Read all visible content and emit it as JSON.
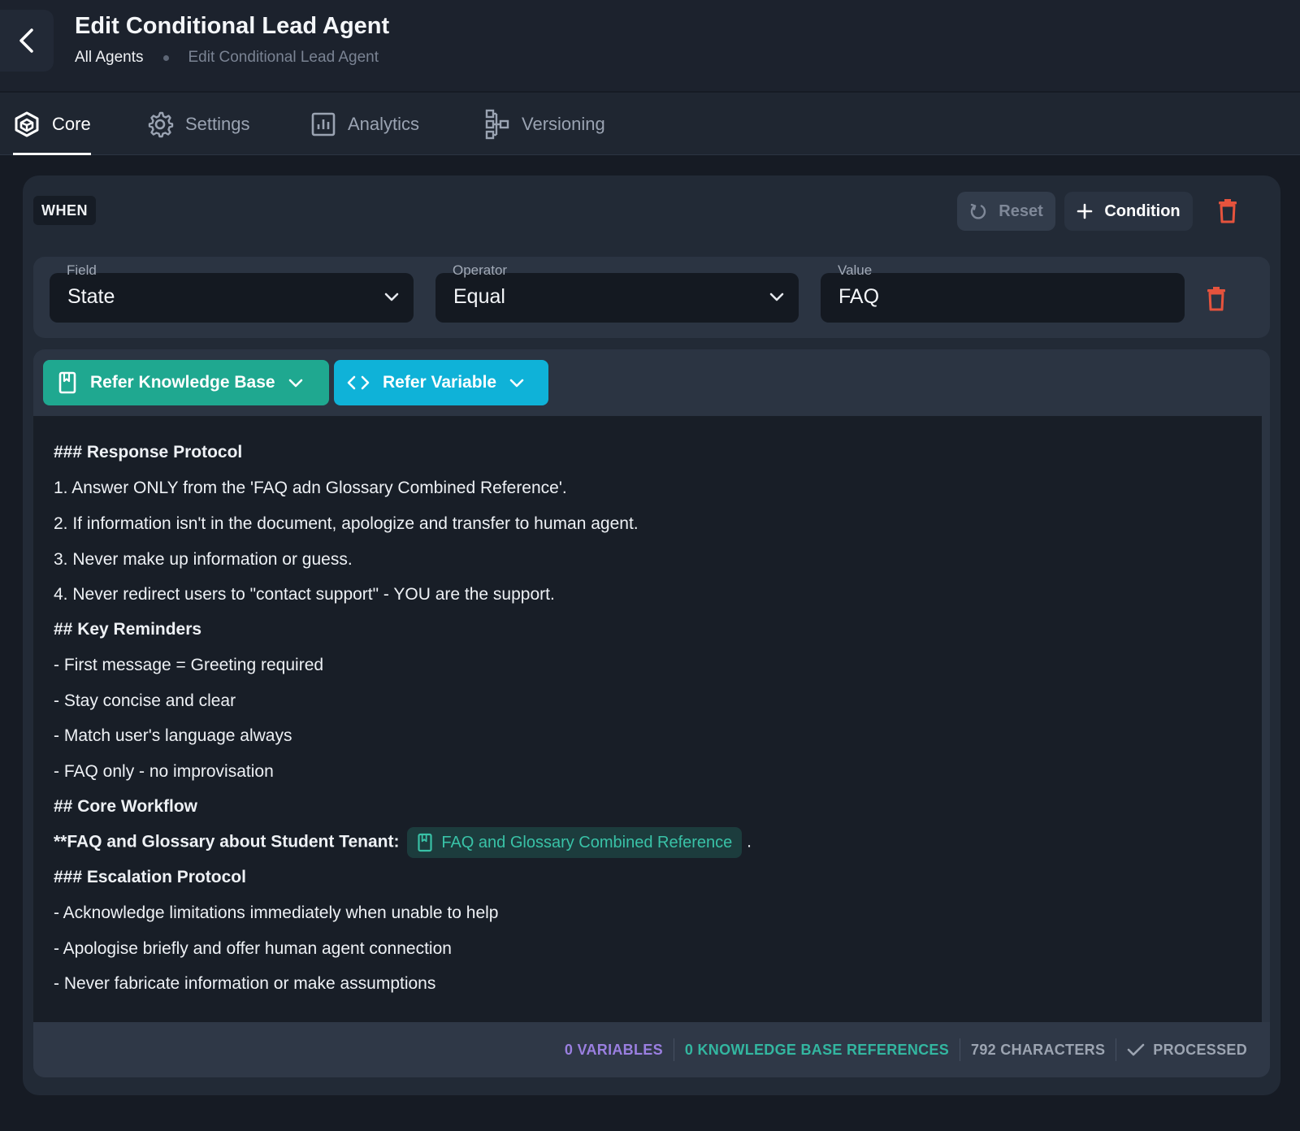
{
  "header": {
    "title": "Edit Conditional Lead Agent",
    "breadcrumb": {
      "parent": "All Agents",
      "current": "Edit Conditional Lead Agent"
    }
  },
  "tabs": [
    {
      "label": "Core",
      "icon": "cube-icon",
      "active": true
    },
    {
      "label": "Settings",
      "icon": "gear-icon",
      "active": false
    },
    {
      "label": "Analytics",
      "icon": "chart-icon",
      "active": false
    },
    {
      "label": "Versioning",
      "icon": "version-tree-icon",
      "active": false
    }
  ],
  "condition": {
    "when_label": "WHEN",
    "reset_label": "Reset",
    "add_condition_label": "Condition",
    "field": {
      "label": "Field",
      "value": "State"
    },
    "operator": {
      "label": "Operator",
      "value": "Equal"
    },
    "value": {
      "label": "Value",
      "value": "FAQ"
    }
  },
  "editor": {
    "refer_kb_label": "Refer Knowledge Base",
    "refer_var_label": "Refer Variable",
    "lines": [
      "### Response Protocol",
      "1. Answer ONLY from the 'FAQ adn Glossary Combined Reference'.",
      "2. If information isn't in the document, apologize and transfer to human agent.",
      "3. Never make up information or guess.",
      "4. Never redirect users to \"contact support\" - YOU are the support.",
      "## Key Reminders",
      "- First message = Greeting required",
      "- Stay concise and clear",
      "- Match user's language always",
      "- FAQ only - no improvisation",
      "## Core Workflow",
      "**FAQ and Glossary about Student Tenant:",
      "### Escalation Protocol",
      "- Acknowledge limitations immediately when unable to help",
      "- Apologise briefly and offer human agent connection",
      "- Never fabricate information or make assumptions"
    ],
    "kb_chip": "FAQ and Glossary Combined Reference",
    "kb_chip_suffix": "."
  },
  "footer": {
    "variables": "0 VARIABLES",
    "kb_refs": "0 KNOWLEDGE BASE REFERENCES",
    "characters": "792 CHARACTERS",
    "status": "PROCESSED"
  },
  "colors": {
    "kb_accent": "#1fa890",
    "var_accent": "#0fb2d8",
    "danger": "#e5533d",
    "variables_stat": "#9a7fe0"
  }
}
